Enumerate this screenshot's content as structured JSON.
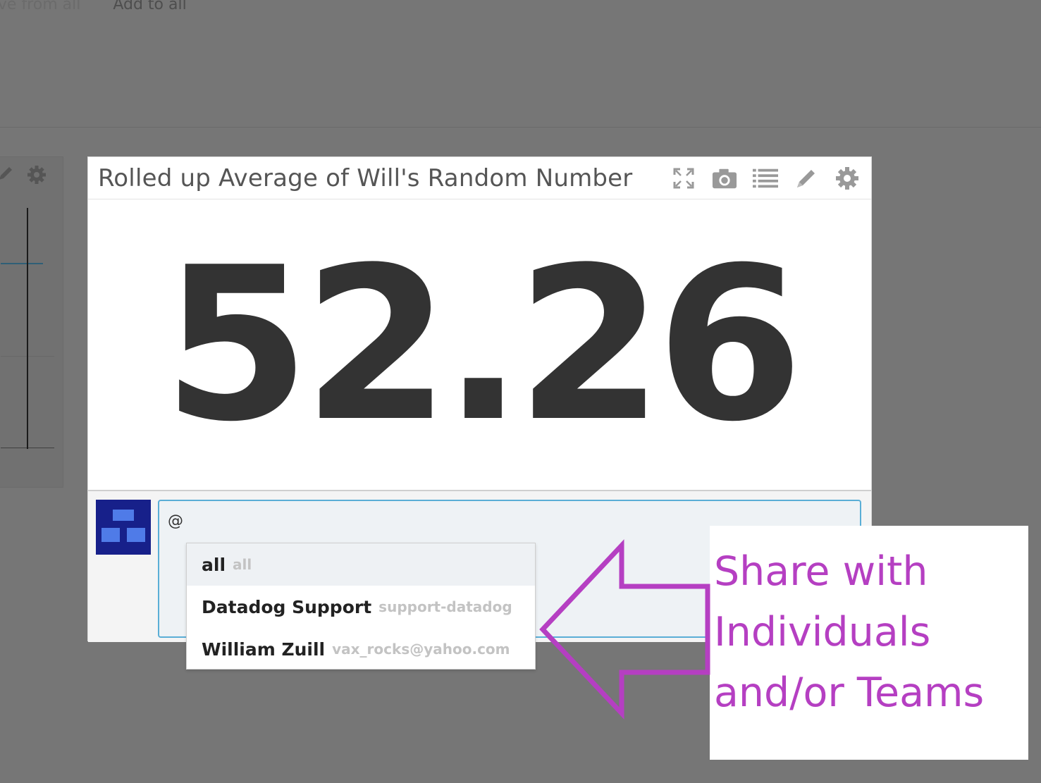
{
  "top_links": {
    "remove_from_all": "move from all",
    "add_to_all": "Add to all"
  },
  "widget": {
    "title": "Rolled up Average of Will's Random Number",
    "value": "52.26",
    "tools": [
      "expand-icon",
      "camera-icon",
      "list-icon",
      "pencil-icon",
      "gear-icon"
    ]
  },
  "comment": {
    "input_value": "@"
  },
  "mention_suggestions": [
    {
      "name": "all",
      "handle": "all"
    },
    {
      "name": "Datadog Support",
      "handle": "support-datadog"
    },
    {
      "name": "William Zuill",
      "handle": "vax_rocks@yahoo.com"
    }
  ],
  "callout": {
    "lines": [
      "Share with",
      "Individuals",
      "and/or Teams"
    ],
    "color": "#b53fc2"
  },
  "colors": {
    "overlay_bg": "#767676",
    "input_border": "#5aaed6",
    "avatar": "#17208a",
    "avatar_blocks": "#4f7be8"
  }
}
